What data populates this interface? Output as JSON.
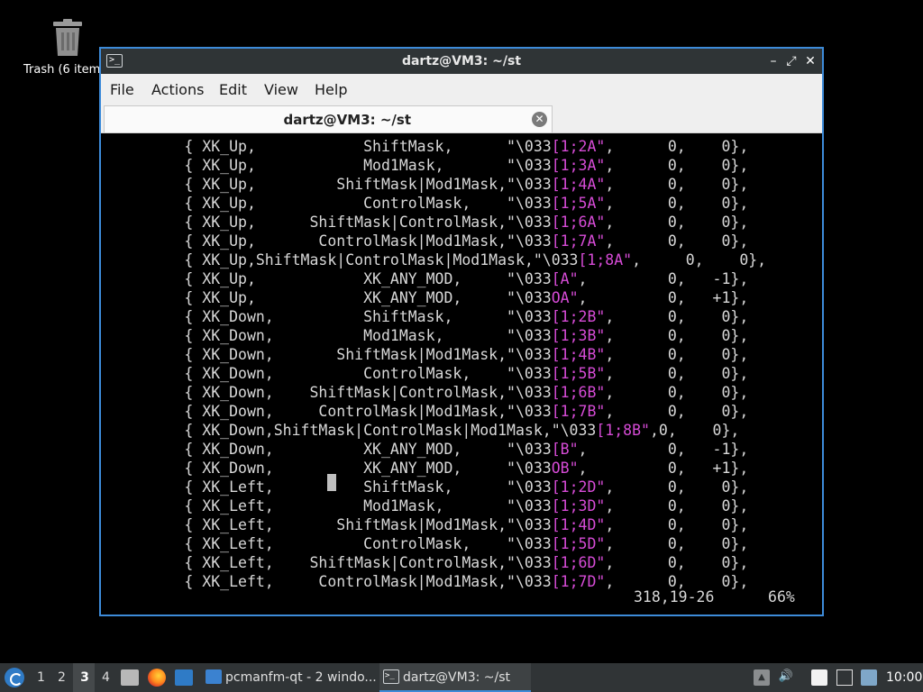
{
  "desktop": {
    "trash_label": "Trash (6 item"
  },
  "window": {
    "title": "dartz@VM3: ~/st",
    "app_icon": ">_",
    "controls": {
      "minimize": "–",
      "maximize": "⤢",
      "close": "✕"
    },
    "menu": [
      "File",
      "Actions",
      "Edit",
      "View",
      "Help"
    ],
    "tab": {
      "label": "dartz@VM3: ~/st",
      "close": "✕"
    }
  },
  "terminal": {
    "lines": [
      {
        "pre": "         { XK_Up,            ShiftMask,      \"\\033",
        "mag": "[1;2A\"",
        "post": ",      0,    0},"
      },
      {
        "pre": "         { XK_Up,            Mod1Mask,       \"\\033",
        "mag": "[1;3A\"",
        "post": ",      0,    0},"
      },
      {
        "pre": "         { XK_Up,         ShiftMask|Mod1Mask,\"\\033",
        "mag": "[1;4A\"",
        "post": ",      0,    0},"
      },
      {
        "pre": "         { XK_Up,            ControlMask,    \"\\033",
        "mag": "[1;5A\"",
        "post": ",      0,    0},"
      },
      {
        "pre": "         { XK_Up,      ShiftMask|ControlMask,\"\\033",
        "mag": "[1;6A\"",
        "post": ",      0,    0},"
      },
      {
        "pre": "         { XK_Up,       ControlMask|Mod1Mask,\"\\033",
        "mag": "[1;7A\"",
        "post": ",      0,    0},"
      },
      {
        "pre": "         { XK_Up,ShiftMask|ControlMask|Mod1Mask,\"\\033",
        "mag": "[1;8A\"",
        "post": ",     0,    0},"
      },
      {
        "pre": "         { XK_Up,            XK_ANY_MOD,     \"\\033",
        "mag": "[A\"",
        "post": ",         0,   -1},"
      },
      {
        "pre": "         { XK_Up,            XK_ANY_MOD,     \"\\033",
        "mag": "OA\"",
        "post": ",         0,   +1},"
      },
      {
        "pre": "         { XK_Down,          ShiftMask,      \"\\033",
        "mag": "[1;2B\"",
        "post": ",      0,    0},"
      },
      {
        "pre": "         { XK_Down,          Mod1Mask,       \"\\033",
        "mag": "[1;3B\"",
        "post": ",      0,    0},"
      },
      {
        "pre": "         { XK_Down,       ShiftMask|Mod1Mask,\"\\033",
        "mag": "[1;4B\"",
        "post": ",      0,    0},"
      },
      {
        "pre": "         { XK_Down,          ControlMask,    \"\\033",
        "mag": "[1;5B\"",
        "post": ",      0,    0},"
      },
      {
        "pre": "         { XK_Down,    ShiftMask|ControlMask,\"\\033",
        "mag": "[1;6B\"",
        "post": ",      0,    0},"
      },
      {
        "pre": "         { XK_Down,     ControlMask|Mod1Mask,\"\\033",
        "mag": "[1;7B\"",
        "post": ",      0,    0},"
      },
      {
        "pre": "         { XK_Down,ShiftMask|ControlMask|Mod1Mask,\"\\033",
        "mag": "[1;8B\"",
        "post": ",0,    0},"
      },
      {
        "pre": "         { XK_Down,          XK_ANY_MOD,     \"\\033",
        "mag": "[B\"",
        "post": ",         0,   -1},"
      },
      {
        "pre": "         { XK_Down,          XK_ANY_MOD,     \"\\033",
        "mag": "OB\"",
        "post": ",         0,   +1},"
      },
      {
        "pre": "         { XK_Left,          ShiftMask,      \"\\033",
        "mag": "[1;2D\"",
        "post": ",      0,    0},"
      },
      {
        "pre": "         { XK_Left,          Mod1Mask,       \"\\033",
        "mag": "[1;3D\"",
        "post": ",      0,    0},"
      },
      {
        "pre": "         { XK_Left,       ShiftMask|Mod1Mask,\"\\033",
        "mag": "[1;4D\"",
        "post": ",      0,    0},"
      },
      {
        "pre": "         { XK_Left,          ControlMask,    \"\\033",
        "mag": "[1;5D\"",
        "post": ",      0,    0},"
      },
      {
        "pre": "         { XK_Left,    ShiftMask|ControlMask,\"\\033",
        "mag": "[1;6D\"",
        "post": ",      0,    0},"
      },
      {
        "pre": "         { XK_Left,     ControlMask|Mod1Mask,\"\\033",
        "mag": "[1;7D\"",
        "post": ",      0,    0},"
      }
    ],
    "status": "318,19-26      66%"
  },
  "taskbar": {
    "workspaces": [
      "1",
      "2",
      "3",
      "4"
    ],
    "tasks": [
      {
        "label": "pcmanfm-qt - 2 windo..."
      },
      {
        "label": "dartz@VM3: ~/st",
        "icon": ">_"
      }
    ],
    "clock": "10:00"
  },
  "colors": {
    "accent": "#3d8bd9",
    "magenta": "#d64bd6",
    "panel": "#303436",
    "titlebar": "#2f3436"
  }
}
